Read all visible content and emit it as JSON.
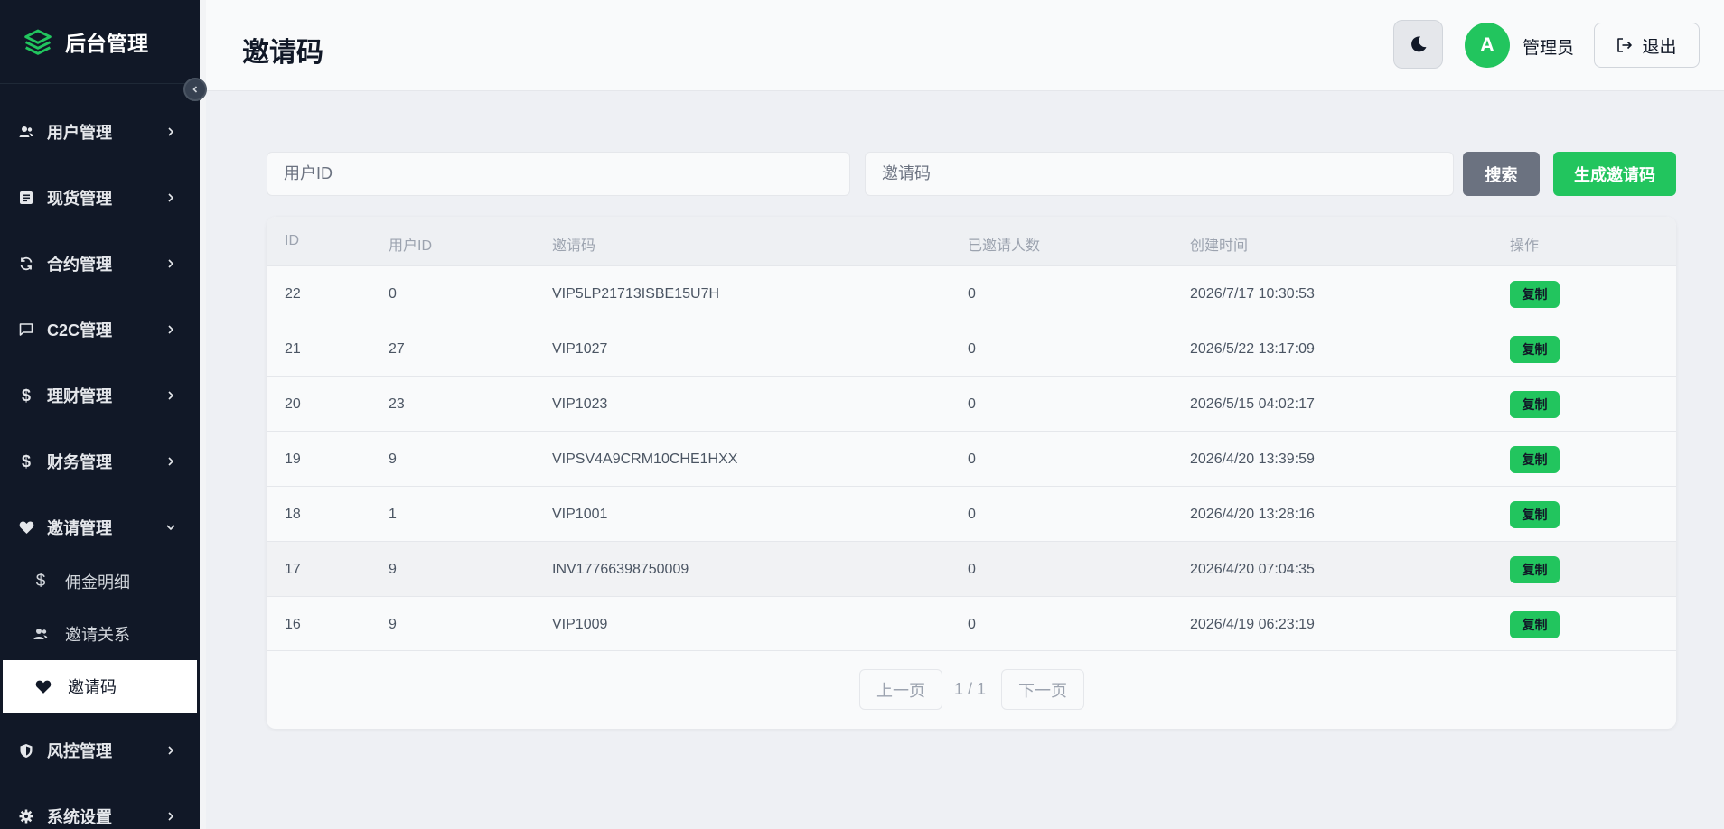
{
  "sidebar": {
    "brand": "后台管理",
    "items": [
      {
        "label": "用户管理",
        "icon": "users-icon"
      },
      {
        "label": "现货管理",
        "icon": "list-icon"
      },
      {
        "label": "合约管理",
        "icon": "refresh-icon"
      },
      {
        "label": "C2C管理",
        "icon": "chat-icon"
      },
      {
        "label": "理财管理",
        "icon": "dollar-icon"
      },
      {
        "label": "财务管理",
        "icon": "dollar-icon"
      },
      {
        "label": "邀请管理",
        "icon": "heart-icon"
      },
      {
        "label": "风控管理",
        "icon": "shield-icon"
      },
      {
        "label": "系统设置",
        "icon": "gear-icon"
      }
    ],
    "subitems": [
      {
        "label": "佣金明细",
        "icon": "dollar-icon"
      },
      {
        "label": "邀请关系",
        "icon": "users-icon"
      },
      {
        "label": "邀请码",
        "icon": "heart-icon",
        "active": true
      }
    ]
  },
  "header": {
    "title": "邀请码",
    "avatar_letter": "A",
    "user_name": "管理员",
    "logout_label": "退出"
  },
  "filters": {
    "user_id_placeholder": "用户ID",
    "code_placeholder": "邀请码",
    "search_label": "搜索",
    "generate_label": "生成邀请码"
  },
  "table": {
    "columns": [
      "ID",
      "用户ID",
      "邀请码",
      "已邀请人数",
      "创建时间",
      "操作"
    ],
    "rows": [
      {
        "id": "22",
        "user_id": "0",
        "code": "VIP5LP21713ISBE15U7H",
        "invited": "0",
        "created": "2026/7/17 10:30:53",
        "action": "复制"
      },
      {
        "id": "21",
        "user_id": "27",
        "code": "VIP1027",
        "invited": "0",
        "created": "2026/5/22 13:17:09",
        "action": "复制"
      },
      {
        "id": "20",
        "user_id": "23",
        "code": "VIP1023",
        "invited": "0",
        "created": "2026/5/15 04:02:17",
        "action": "复制"
      },
      {
        "id": "19",
        "user_id": "9",
        "code": "VIPSV4A9CRM10CHE1HXX",
        "invited": "0",
        "created": "2026/4/20 13:39:59",
        "action": "复制"
      },
      {
        "id": "18",
        "user_id": "1",
        "code": "VIP1001",
        "invited": "0",
        "created": "2026/4/20 13:28:16",
        "action": "复制"
      },
      {
        "id": "17",
        "user_id": "9",
        "code": "INV17766398750009",
        "invited": "0",
        "created": "2026/4/20 07:04:35",
        "action": "复制"
      },
      {
        "id": "16",
        "user_id": "9",
        "code": "VIP1009",
        "invited": "0",
        "created": "2026/4/19 06:23:19",
        "action": "复制"
      }
    ]
  },
  "pagination": {
    "prev_label": "上一页",
    "page_info": "1 / 1",
    "next_label": "下一页"
  },
  "colors": {
    "accent": "#22c55e",
    "sidebar_bg": "#111827"
  }
}
